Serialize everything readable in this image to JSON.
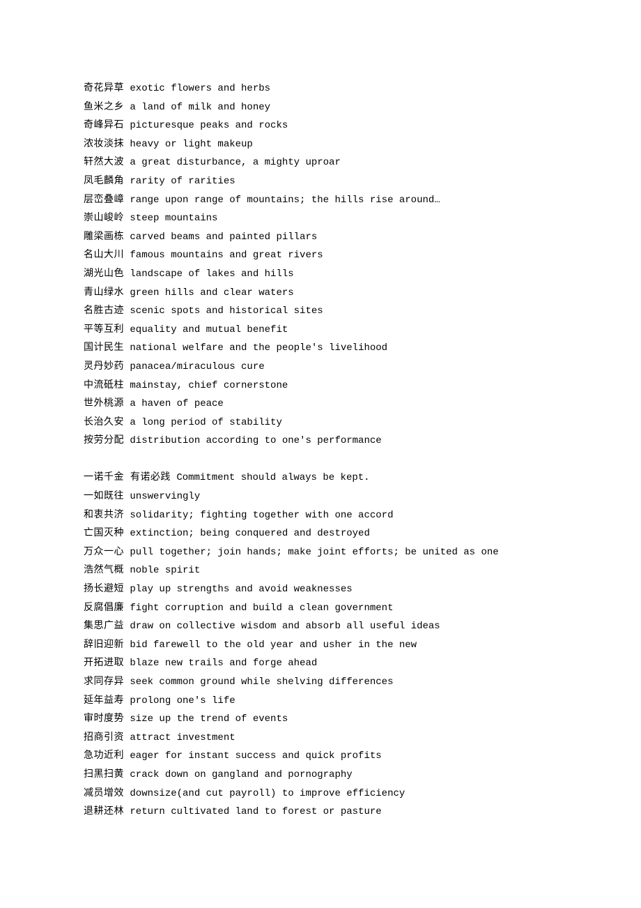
{
  "entries": [
    {
      "type": "line",
      "cn": "奇花异草",
      "en": "exotic flowers and herbs"
    },
    {
      "type": "line",
      "cn": "鱼米之乡",
      "en": "a land of milk and honey"
    },
    {
      "type": "line",
      "cn": "奇峰异石",
      "en": "picturesque peaks and rocks"
    },
    {
      "type": "line",
      "cn": "浓妆淡抹",
      "en": "heavy or light makeup"
    },
    {
      "type": "line",
      "cn": "轩然大波",
      "en": "a great disturbance, a mighty uproar"
    },
    {
      "type": "line",
      "cn": "凤毛麟角",
      "en": "rarity of rarities"
    },
    {
      "type": "line",
      "cn": "层峦叠嶂",
      "en": "range upon range of mountains; the hills rise around…"
    },
    {
      "type": "line",
      "cn": "崇山峻岭",
      "en": "steep mountains"
    },
    {
      "type": "line",
      "cn": "雕梁画栋",
      "en": "carved beams and painted pillars"
    },
    {
      "type": "line",
      "cn": "名山大川",
      "en": "famous mountains and great rivers"
    },
    {
      "type": "line",
      "cn": "湖光山色",
      "en": "landscape of lakes and hills"
    },
    {
      "type": "line",
      "cn": "青山绿水",
      "en": "green hills and clear waters"
    },
    {
      "type": "line",
      "cn": "名胜古迹",
      "en": "scenic spots and historical sites"
    },
    {
      "type": "line",
      "cn": "平等互利",
      "en": "equality and mutual benefit"
    },
    {
      "type": "line",
      "cn": "国计民生",
      "en": "national welfare and the people's livelihood"
    },
    {
      "type": "line",
      "cn": "灵丹妙药",
      "en": "panacea/miraculous cure"
    },
    {
      "type": "line",
      "cn": "中流砥柱",
      "en": "mainstay, chief cornerstone"
    },
    {
      "type": "line",
      "cn": "世外桃源",
      "en": "a haven of peace"
    },
    {
      "type": "line",
      "cn": "长治久安",
      "en": "a long period of stability"
    },
    {
      "type": "line",
      "cn": "按劳分配",
      "en": "distribution according to one's performance"
    },
    {
      "type": "blank"
    },
    {
      "type": "line",
      "cn": "一诺千金 有诺必践",
      "en": "Commitment should always be kept."
    },
    {
      "type": "line",
      "cn": "一如既往",
      "en": "unswervingly"
    },
    {
      "type": "line",
      "cn": "和衷共济",
      "en": "solidarity; fighting together with one accord"
    },
    {
      "type": "line",
      "cn": "亡国灭种",
      "en": "extinction; being conquered and destroyed"
    },
    {
      "type": "line",
      "cn": "万众一心",
      "en": "pull together; join hands; make joint efforts; be united as one"
    },
    {
      "type": "line",
      "cn": "浩然气概",
      "en": "noble spirit"
    },
    {
      "type": "line",
      "cn": "扬长避短",
      "en": "play up strengths and avoid weaknesses"
    },
    {
      "type": "line",
      "cn": "反腐倡廉",
      "en": "fight corruption and build a clean government"
    },
    {
      "type": "line",
      "cn": "集思广益",
      "en": "draw on collective wisdom and absorb all useful ideas"
    },
    {
      "type": "line",
      "cn": "辞旧迎新",
      "en": "bid farewell to the old year and usher in the new"
    },
    {
      "type": "line",
      "cn": "开拓进取",
      "en": "blaze new trails and forge ahead"
    },
    {
      "type": "line",
      "cn": "求同存异",
      "en": "seek common ground while shelving differences"
    },
    {
      "type": "line",
      "cn": "延年益寿",
      "en": "prolong one's life"
    },
    {
      "type": "line",
      "cn": "审时度势",
      "en": "size up the trend of events"
    },
    {
      "type": "line",
      "cn": "招商引资",
      "en": "attract investment"
    },
    {
      "type": "line",
      "cn": "急功近利",
      "en": "eager for instant success and quick profits"
    },
    {
      "type": "line",
      "cn": "扫黑扫黄",
      "en": "crack down on gangland and pornography"
    },
    {
      "type": "line",
      "cn": "减员增效",
      "en": "downsize(and cut payroll) to improve efficiency"
    },
    {
      "type": "line",
      "cn": "退耕还林",
      "en": "return cultivated land to forest or pasture"
    }
  ]
}
